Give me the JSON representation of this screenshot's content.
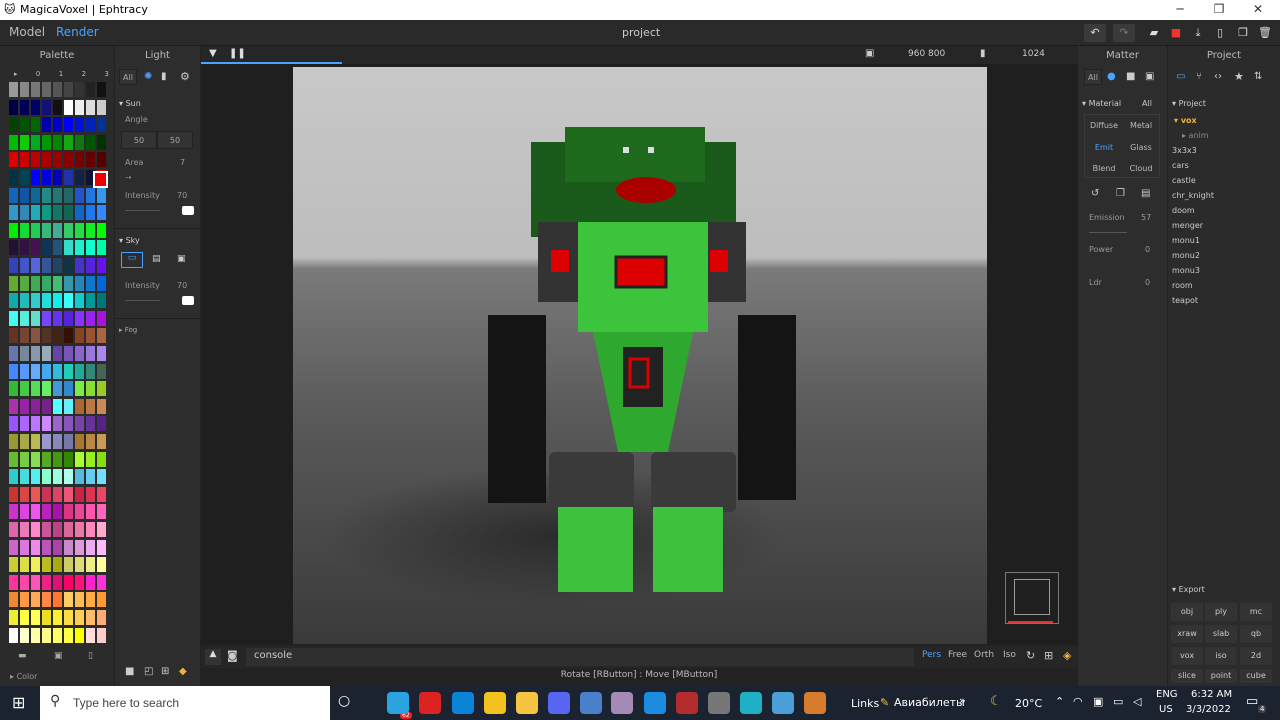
{
  "window": {
    "title": "MagicaVoxel | Ephtracy",
    "controls": [
      "─",
      "❐",
      "✕"
    ]
  },
  "appbar": {
    "tabs": [
      "Model",
      "Render"
    ],
    "project": "project"
  },
  "palette": {
    "header": "Palette",
    "page_tabs": [
      "▸",
      "0",
      "1",
      "2",
      "3"
    ],
    "footer": "Color"
  },
  "light": {
    "header": "Light",
    "filters": [
      "All"
    ],
    "sun": {
      "title": "Sun",
      "angle_label": "Angle",
      "angle_a": "50",
      "angle_b": "50",
      "area_label": "Area",
      "area_value": "7",
      "intensity_label": "Intensity",
      "intensity_value": "70"
    },
    "sky": {
      "title": "Sky",
      "intensity_label": "Intensity",
      "intensity_value": "70"
    },
    "fog": {
      "title": "Fog"
    }
  },
  "viewport": {
    "resolution": "960  800",
    "samples": "1024",
    "console": "console",
    "view_modes": [
      "Pers",
      "Free",
      "Orth",
      "Iso"
    ],
    "status": "Rotate [RButton] : Move [MButton]"
  },
  "matter": {
    "header": "Matter",
    "filters": [
      "All"
    ],
    "material": {
      "title": "Material",
      "all": "All",
      "types": [
        "Diffuse",
        "Metal",
        "Emit",
        "Glass",
        "Blend",
        "Cloud"
      ]
    },
    "emission_label": "Emission",
    "emission_value": "57",
    "power_label": "Power",
    "power_value": "0",
    "ldr_label": "Ldr",
    "ldr_value": "0"
  },
  "project": {
    "header": "Project",
    "section": "Project",
    "folder": "vox",
    "items": [
      "anim",
      "3x3x3",
      "cars",
      "castle",
      "chr_knight",
      "doom",
      "menger",
      "monu1",
      "monu2",
      "monu3",
      "room",
      "teapot"
    ],
    "export_title": "Export",
    "export": [
      "obj",
      "ply",
      "mc",
      "xraw",
      "slab",
      "qb",
      "vox",
      "iso",
      "2d",
      "slice",
      "point",
      "cube"
    ]
  },
  "taskbar": {
    "search_placeholder": "Type here to search",
    "links": "Links",
    "tickets": "Авиабилеты",
    "weather": "20°C",
    "lang_top": "ENG",
    "lang_bot": "US",
    "time": "6:32 AM",
    "date": "3/3/2022",
    "notif": "4",
    "badge": "62"
  }
}
